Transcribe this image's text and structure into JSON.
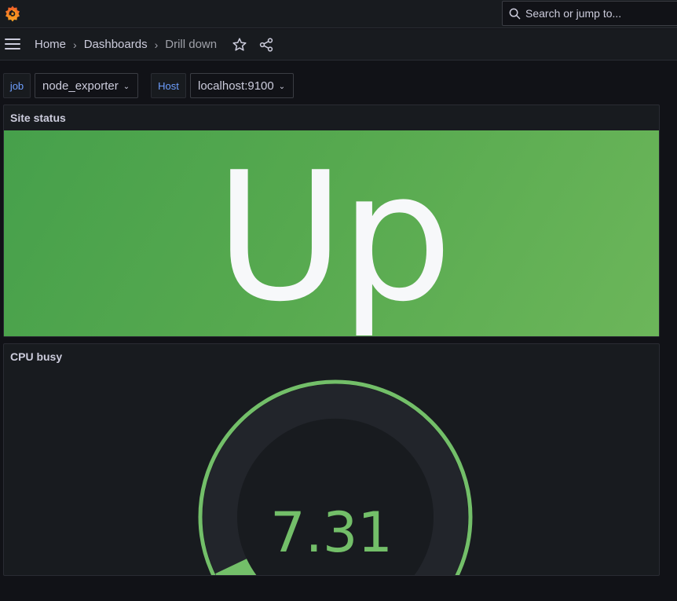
{
  "topbar": {
    "search_placeholder": "Search or jump to..."
  },
  "breadcrumb": {
    "items": [
      "Home",
      "Dashboards",
      "Drill down"
    ]
  },
  "variables": [
    {
      "label": "job",
      "value": "node_exporter"
    },
    {
      "label": "Host",
      "value": "localhost:9100"
    }
  ],
  "panels": {
    "site_status": {
      "title": "Site status",
      "value": "Up"
    },
    "cpu_busy": {
      "title": "CPU busy",
      "value": "7.31",
      "gauge_fraction": 0.0731
    }
  },
  "colors": {
    "accent_green": "#73bf69",
    "link_blue": "#6e9fff",
    "background": "#111217",
    "panel": "#181b1f"
  },
  "icons": [
    "grafana-logo-icon",
    "search-icon",
    "menu-icon",
    "chevron-right-icon",
    "star-icon",
    "share-icon",
    "chevron-down-icon"
  ]
}
